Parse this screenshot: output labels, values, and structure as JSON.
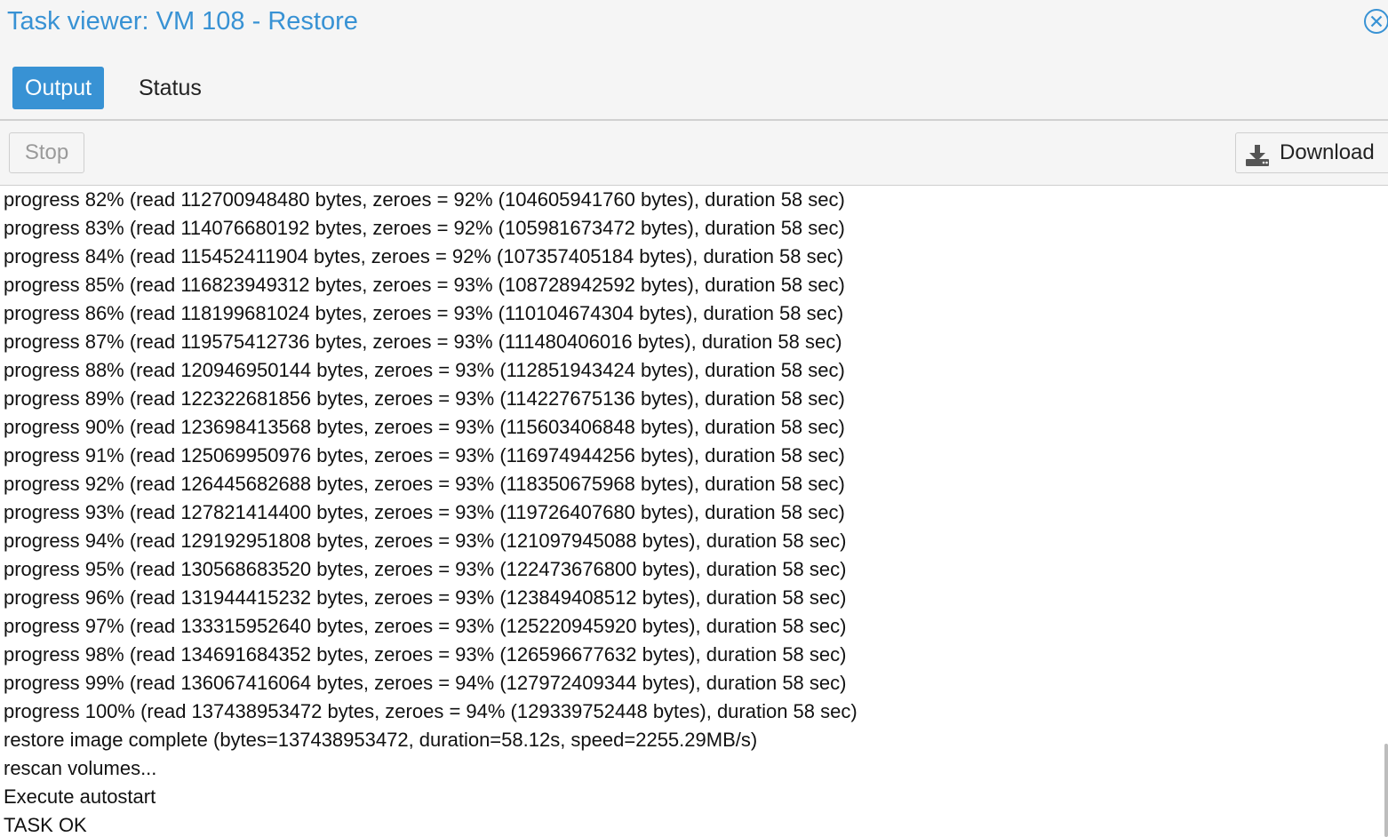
{
  "window": {
    "title": "Task viewer: VM 108 - Restore",
    "close_icon": "close-circle-icon"
  },
  "tabs": [
    {
      "label": "Output",
      "active": true
    },
    {
      "label": "Status",
      "active": false
    }
  ],
  "toolbar": {
    "stop_label": "Stop",
    "stop_enabled": false,
    "download_label": "Download",
    "download_icon": "download-icon"
  },
  "colors": {
    "accent": "#3892d4",
    "text": "#111111",
    "disabled_text": "#9a9a9a",
    "background": "#f5f5f5"
  },
  "log": {
    "lines": [
      "progress 82% (read 112700948480 bytes, zeroes = 92% (104605941760 bytes), duration 58 sec)",
      "progress 83% (read 114076680192 bytes, zeroes = 92% (105981673472 bytes), duration 58 sec)",
      "progress 84% (read 115452411904 bytes, zeroes = 92% (107357405184 bytes), duration 58 sec)",
      "progress 85% (read 116823949312 bytes, zeroes = 93% (108728942592 bytes), duration 58 sec)",
      "progress 86% (read 118199681024 bytes, zeroes = 93% (110104674304 bytes), duration 58 sec)",
      "progress 87% (read 119575412736 bytes, zeroes = 93% (111480406016 bytes), duration 58 sec)",
      "progress 88% (read 120946950144 bytes, zeroes = 93% (112851943424 bytes), duration 58 sec)",
      "progress 89% (read 122322681856 bytes, zeroes = 93% (114227675136 bytes), duration 58 sec)",
      "progress 90% (read 123698413568 bytes, zeroes = 93% (115603406848 bytes), duration 58 sec)",
      "progress 91% (read 125069950976 bytes, zeroes = 93% (116974944256 bytes), duration 58 sec)",
      "progress 92% (read 126445682688 bytes, zeroes = 93% (118350675968 bytes), duration 58 sec)",
      "progress 93% (read 127821414400 bytes, zeroes = 93% (119726407680 bytes), duration 58 sec)",
      "progress 94% (read 129192951808 bytes, zeroes = 93% (121097945088 bytes), duration 58 sec)",
      "progress 95% (read 130568683520 bytes, zeroes = 93% (122473676800 bytes), duration 58 sec)",
      "progress 96% (read 131944415232 bytes, zeroes = 93% (123849408512 bytes), duration 58 sec)",
      "progress 97% (read 133315952640 bytes, zeroes = 93% (125220945920 bytes), duration 58 sec)",
      "progress 98% (read 134691684352 bytes, zeroes = 93% (126596677632 bytes), duration 58 sec)",
      "progress 99% (read 136067416064 bytes, zeroes = 94% (127972409344 bytes), duration 58 sec)",
      "progress 100% (read 137438953472 bytes, zeroes = 94% (129339752448 bytes), duration 58 sec)",
      "restore image complete (bytes=137438953472, duration=58.12s, speed=2255.29MB/s)",
      "rescan volumes...",
      "Execute autostart",
      "TASK OK"
    ]
  }
}
